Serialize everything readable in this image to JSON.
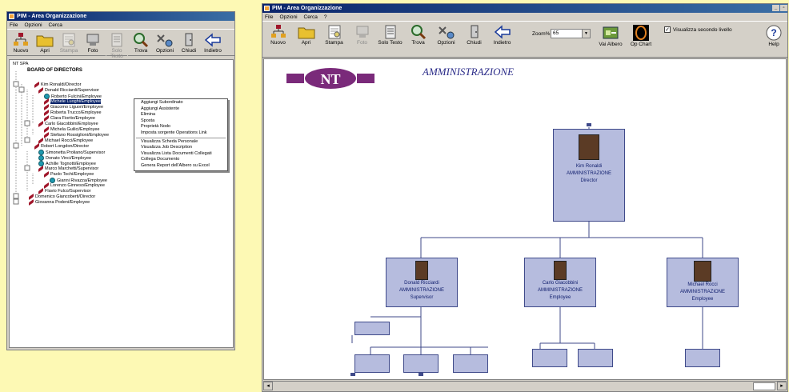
{
  "left": {
    "title": "PIM - Area Organizzazione",
    "menu": [
      "File",
      "Opzioni",
      "Cerca"
    ],
    "toolbar": [
      {
        "label": "Nuovo",
        "icon": "org-chart-icon",
        "disabled": false
      },
      {
        "label": "Apri",
        "icon": "folder-icon",
        "disabled": false
      },
      {
        "label": "Stampa",
        "icon": "print-preview-icon",
        "disabled": true
      },
      {
        "label": "Foto",
        "icon": "photo-icon",
        "disabled": false
      },
      {
        "label": "Solo Testo",
        "icon": "text-doc-icon",
        "disabled": true
      },
      {
        "label": "Trova",
        "icon": "magnifier-icon",
        "disabled": false
      },
      {
        "label": "Opzioni",
        "icon": "options-icon",
        "disabled": false
      },
      {
        "label": "Chiudi",
        "icon": "close-door-icon",
        "disabled": false
      },
      {
        "label": "Indietro",
        "icon": "back-arrow-icon",
        "disabled": false
      }
    ],
    "tree": {
      "root": "NT SPA",
      "board": "BOARD OF DIRECTORS",
      "nodes": [
        "Kim Ronaldi/Director",
        "Donald Ricciardi/Supervisor",
        "Roberto Fulcini/Employee",
        "Michele Luoghi/Employee",
        "Giacomo Liguori/Employee",
        "Roberta Trucco/Employee",
        "Clara Fiorito/Employee",
        "Carlo Giacobbini/Employee",
        "Michela Guilici/Employee",
        "Stefano Rossiglioni/Employee",
        "Michael Rocci/Employee",
        "Robert Longdon/Director",
        "Simonetta Proliano/Supervisor",
        "Donato Vinci/Employee",
        "Achille Tognotti/Employee",
        "Marco Marchetti/Supervisor",
        "Paolo Tochi/Employee",
        "Gianni Rivazza/Employee",
        "Lorenzo Ginneso/Employee",
        "Flavio Fulco/Supervisor",
        "Domenico Giancoberti/Director",
        "Giovanna Podeni/Employee"
      ]
    },
    "context_menu": [
      "Aggiungi Subordinato",
      "Aggiungi Assistente",
      "Elimina",
      "Sposta",
      "Proprietà Nodo",
      "Imposta sorgente Operations Link",
      "Visualizza Scheda Personale",
      "Visualizza Job Description",
      "Visualizza Lista Documenti Collegati",
      "Collega Documento",
      "Genera Report dell'Albero su Excel"
    ]
  },
  "right": {
    "title": "PIM - Area Organizzazione",
    "menu": [
      "File",
      "Opzioni",
      "Cerca",
      "?"
    ],
    "toolbar": [
      {
        "label": "Nuovo",
        "icon": "org-chart-icon",
        "disabled": false
      },
      {
        "label": "Apri",
        "icon": "folder-icon",
        "disabled": false
      },
      {
        "label": "Stampa",
        "icon": "print-preview-icon",
        "disabled": false
      },
      {
        "label": "Foto",
        "icon": "photo-icon",
        "disabled": true
      },
      {
        "label": "Solo Testo",
        "icon": "text-doc-icon",
        "disabled": false
      },
      {
        "label": "Trova",
        "icon": "magnifier-icon",
        "disabled": false
      },
      {
        "label": "Opzioni",
        "icon": "options-icon",
        "disabled": false
      },
      {
        "label": "Chiudi",
        "icon": "close-door-icon",
        "disabled": false
      },
      {
        "label": "Indietro",
        "icon": "back-arrow-icon",
        "disabled": false
      }
    ],
    "zoom_label": "Zoom%",
    "zoom_value": "65",
    "vai_albero": "Vai Albero",
    "op_chart": "Op Chart",
    "checkbox_label": "Visualizza secondo livello",
    "checkbox_checked": true,
    "help": "Help",
    "logo_text": "NT",
    "chart_title": "AMMINISTRAZIONE",
    "cards": {
      "top": {
        "name": "Kim Ronaldi",
        "dept": "AMMINISTRAZIONE",
        "role": "Director"
      },
      "c1": {
        "name": "Donald Ricciardi",
        "dept": "AMMINISTRAZIONE",
        "role": "Supervisor"
      },
      "c2": {
        "name": "Carlo Giacobbini",
        "dept": "AMMINISTRAZIONE",
        "role": "Employee"
      },
      "c3": {
        "name": "Michael Rocci",
        "dept": "AMMINISTRAZIONE",
        "role": "Employee"
      }
    }
  },
  "colors": {
    "desktop": "#fdf9b4",
    "title_start": "#0a246a",
    "title_end": "#3a6ea5",
    "card_bg": "#b6bcde",
    "card_border": "#3f4a8a",
    "line": "#3f4a8a",
    "pin": "#a0162a",
    "dot": "#1e9ab0",
    "chart_title": "#2d2e8a"
  }
}
